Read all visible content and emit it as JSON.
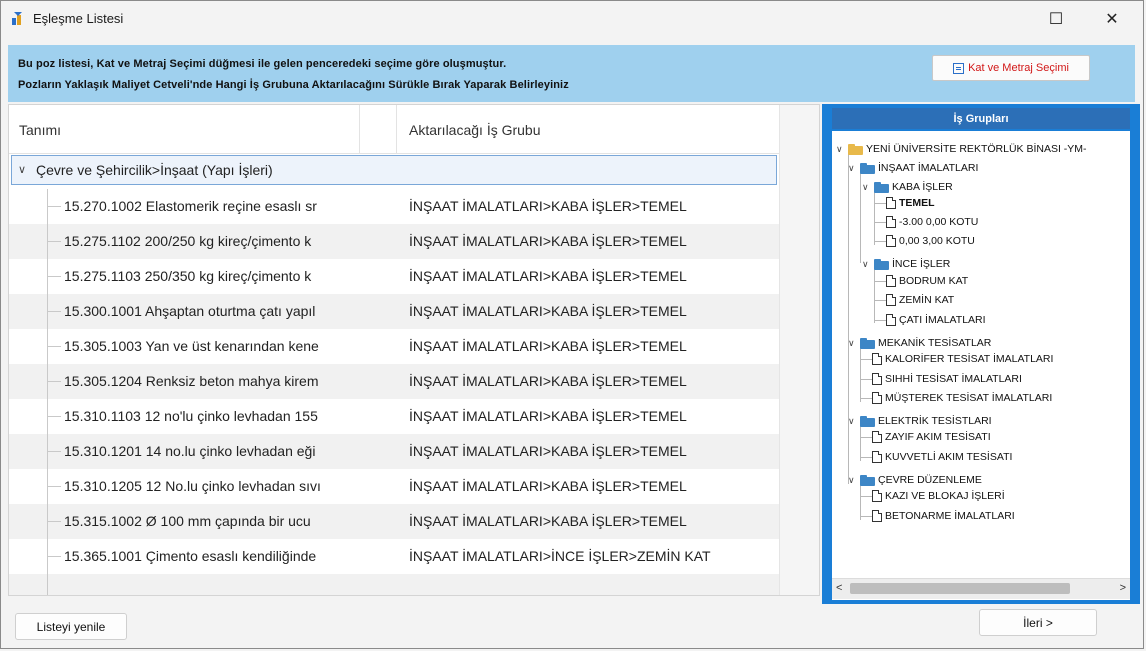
{
  "window": {
    "title": "Eşleşme Listesi",
    "maximize_glyph": "☐",
    "close_glyph": "✕"
  },
  "banner": {
    "line1": "Bu poz listesi, Kat ve Metraj Seçimi düğmesi ile gelen penceredeki seçime göre oluşmuştur.",
    "line2": "Pozların Yaklaşık Maliyet Cetveli'nde Hangi İş Grubuna  Aktarılacağını Sürükle Bırak Yaparak Belirleyiniz",
    "button_label": "Kat ve Metraj Seçimi"
  },
  "grid": {
    "columns": [
      "Tanımı",
      "Aktarılacağı İş Grubu"
    ],
    "group": {
      "toggle": "∨",
      "label": "Çevre ve Şehircilik>İnşaat (Yapı İşleri)"
    },
    "rows": [
      {
        "code": "15.270.1002",
        "desc": "Elastomerik reçine esaslı sr",
        "target": "İNŞAAT İMALATLARI>KABA İŞLER>TEMEL"
      },
      {
        "code": "15.275.1102",
        "desc": "200/250 kg kireç/çimento k",
        "target": "İNŞAAT İMALATLARI>KABA İŞLER>TEMEL"
      },
      {
        "code": "15.275.1103",
        "desc": "250/350 kg kireç/çimento k",
        "target": "İNŞAAT İMALATLARI>KABA İŞLER>TEMEL"
      },
      {
        "code": "15.300.1001",
        "desc": "Ahşaptan oturtma çatı yapıl",
        "target": "İNŞAAT İMALATLARI>KABA İŞLER>TEMEL"
      },
      {
        "code": "15.305.1003",
        "desc": "Yan ve üst kenarından kene",
        "target": "İNŞAAT İMALATLARI>KABA İŞLER>TEMEL"
      },
      {
        "code": "15.305.1204",
        "desc": "Renksiz beton mahya kirem",
        "target": "İNŞAAT İMALATLARI>KABA İŞLER>TEMEL"
      },
      {
        "code": "15.310.1103",
        "desc": "12 no'lu çinko levhadan 155",
        "target": "İNŞAAT İMALATLARI>KABA İŞLER>TEMEL"
      },
      {
        "code": "15.310.1201",
        "desc": "14 no.lu çinko levhadan eği",
        "target": "İNŞAAT İMALATLARI>KABA İŞLER>TEMEL"
      },
      {
        "code": "15.310.1205",
        "desc": "12 No.lu çinko levhadan sıvı",
        "target": "İNŞAAT İMALATLARI>KABA İŞLER>TEMEL"
      },
      {
        "code": "15.315.1002",
        "desc": "Ø 100 mm çapında bir ucu",
        "target": "İNŞAAT İMALATLARI>KABA İŞLER>TEMEL"
      },
      {
        "code": "15.365.1001",
        "desc": "Çimento esaslı kendiliğinde",
        "target": "İNŞAAT İMALATLARI>İNCE İŞLER>ZEMİN KAT"
      }
    ]
  },
  "tree": {
    "header": "İş Grupları",
    "toggle_glyph": "∨",
    "scroll_left": "<",
    "scroll_right": ">",
    "nodes": [
      {
        "label": "YENİ ÜNİVERSİTE REKTÖRLÜK BİNASI -YM-"
      },
      {
        "label": "İNŞAAT İMALATLARI"
      },
      {
        "label": "KABA İŞLER"
      },
      {
        "label": "TEMEL"
      },
      {
        "label": "-3.00  0,00 KOTU"
      },
      {
        "label": "0,00  3,00 KOTU"
      },
      {
        "label": "İNCE İŞLER"
      },
      {
        "label": "BODRUM KAT"
      },
      {
        "label": "ZEMİN KAT"
      },
      {
        "label": "ÇATI İMALATLARI"
      },
      {
        "label": "MEKANİK TESİSATLAR"
      },
      {
        "label": "KALORİFER TESİSAT İMALATLARI"
      },
      {
        "label": "SIHHİ TESİSAT İMALATLARI"
      },
      {
        "label": "MÜŞTEREK TESİSAT İMALATLARI"
      },
      {
        "label": "ELEKTRİK TESİSTLARI"
      },
      {
        "label": "ZAYIF AKIM TESİSATI"
      },
      {
        "label": "KUVVETLİ AKIM TESİSATI"
      },
      {
        "label": "ÇEVRE DÜZENLEME"
      },
      {
        "label": "KAZI VE BLOKAJ İŞLERİ"
      },
      {
        "label": "BETONARME İMALATLARI"
      }
    ]
  },
  "footer": {
    "refresh_label": "Listeyi yenile",
    "next_label": "İleri >"
  }
}
